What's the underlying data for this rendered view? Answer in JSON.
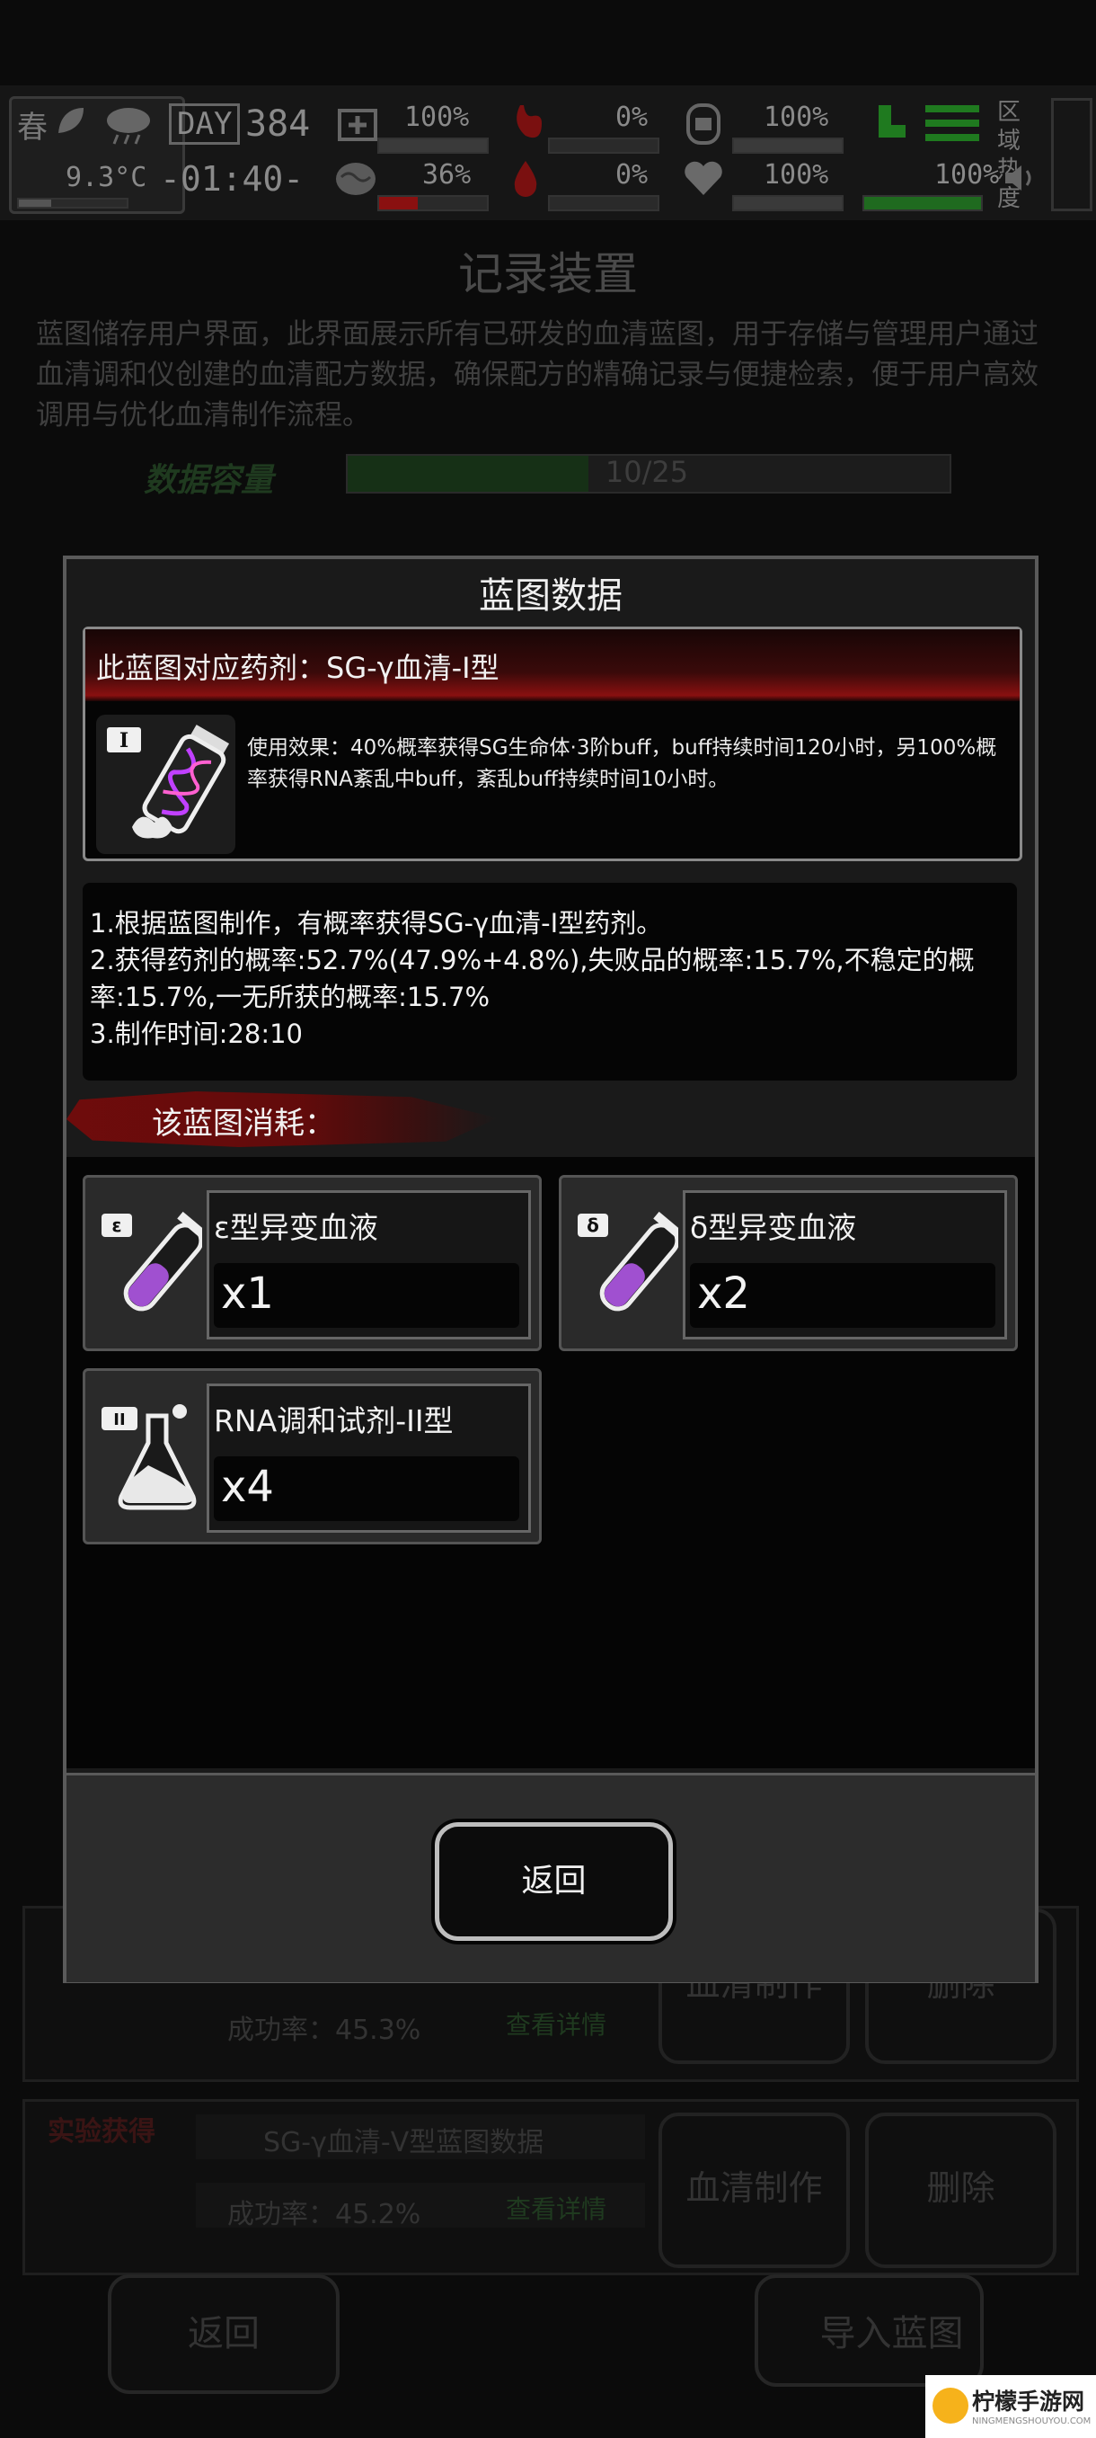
{
  "status_bar": {
    "season": "春",
    "temperature": "9.3°C",
    "day_label": "DAY",
    "day_value": "384",
    "clock": "-01:40-",
    "health_percent": "100%",
    "brain_percent": "36%",
    "blood_percent": "0%",
    "drop_percent": "0%",
    "stomach_percent": "100%",
    "heart_percent": "100%",
    "stamina_percent": "100%",
    "water_percent": "100%",
    "region_label": "区域热度",
    "colors": {
      "green": "#2fb02f",
      "red": "#c01818"
    }
  },
  "background_page": {
    "title": "记录装置",
    "description": "蓝图储存用户界面，此界面展示所有已研发的血清蓝图，用于存储与管理用户通过血清调和仪创建的血清配方数据，确保配方的精确记录与便捷检索，便于用户高效调用与优化血清制作流程。",
    "capacity_label": "数据容量",
    "capacity_text": "10/25",
    "capacity_fraction": 0.4,
    "card_a": {
      "rate": "成功率：45.3%",
      "detail": "查看详情",
      "make": "血清制作",
      "delete": "删除"
    },
    "card_b": {
      "source": "实验获得",
      "title": "SG-γ血清-V型蓝图数据",
      "rate": "成功率：45.2%",
      "detail": "查看详情",
      "make": "血清制作",
      "delete": "删除"
    },
    "return_button": "返回",
    "import_button": "导入蓝图"
  },
  "modal": {
    "title": "蓝图数据",
    "drug_name": "此蓝图对应药剂：SG-γ血清-I型",
    "drug_badge": "I",
    "effect": "使用效果：40%概率获得SG生命体·3阶buff，buff持续时间120小时，另100%概率获得RNA紊乱中buff，紊乱buff持续时间10小时。",
    "info_lines": [
      "1.根据蓝图制作，有概率获得SG-γ血清-I型药剂。",
      "2.获得药剂的概率:52.7%(47.9%+4.8%),失败品的概率:15.7%,不稳定的概",
      "率:15.7%,一无所获的概率:15.7%",
      "3.制作时间:28:10"
    ],
    "consume_label": "该蓝图消耗：",
    "materials": [
      {
        "badge": "ε",
        "name": "ε型异变血液",
        "qty": "x1"
      },
      {
        "badge": "δ",
        "name": "δ型异变血液",
        "qty": "x2"
      },
      {
        "badge": "II",
        "name": "RNA调和试剂-II型",
        "qty": "x4"
      }
    ],
    "return_button": "返回"
  },
  "watermark": {
    "name": "柠檬手游网",
    "sub": "NINGMENGSHOUYOU.COM"
  }
}
